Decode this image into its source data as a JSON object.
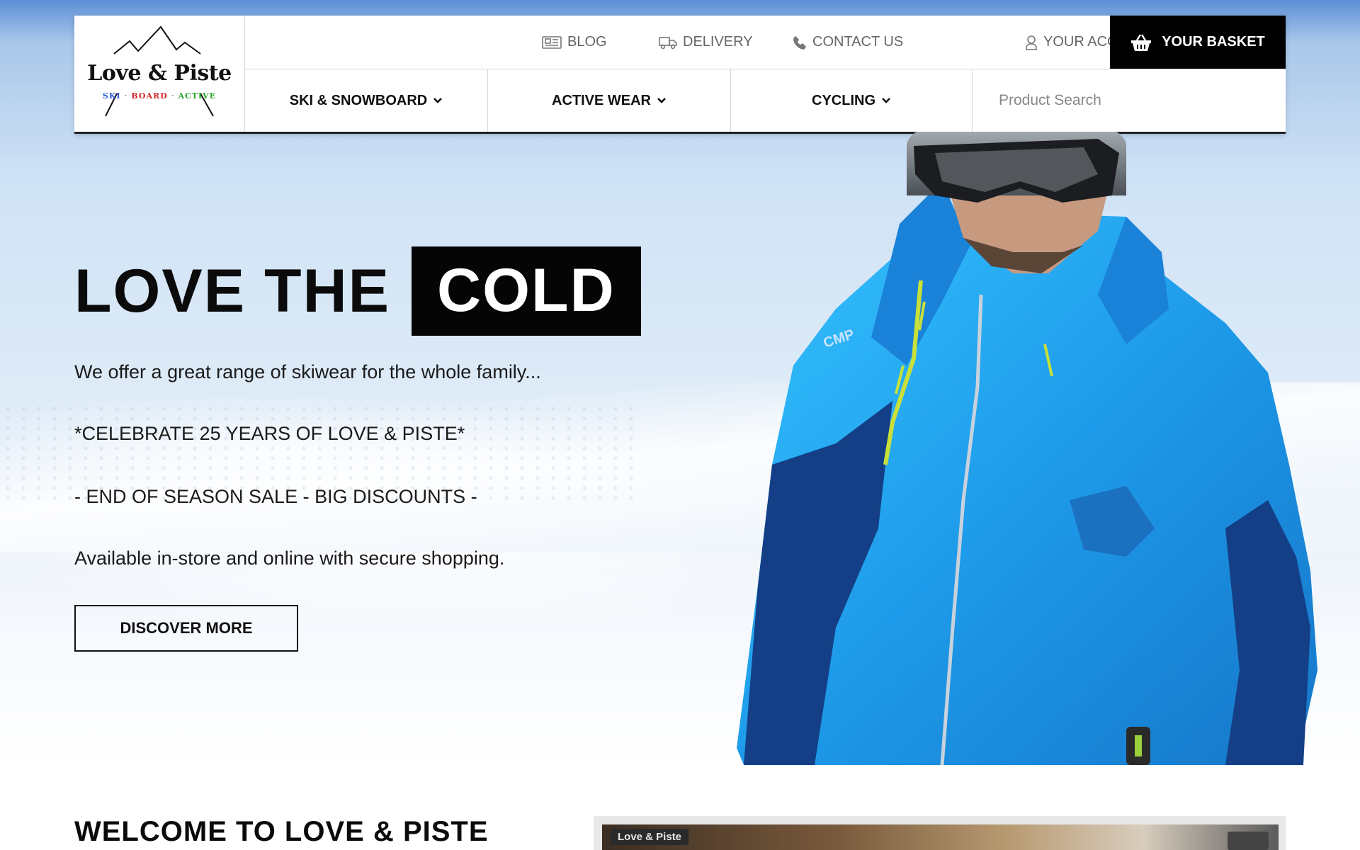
{
  "header": {
    "logo": {
      "name": "Love & Piste",
      "tag_ski": "SKI",
      "tag_board": "BOARD",
      "tag_active": "ACTIVE"
    },
    "top_links": [
      {
        "label": "BLOG",
        "icon": "newspaper-icon"
      },
      {
        "label": "DELIVERY",
        "icon": "truck-icon"
      },
      {
        "label": "CONTACT US",
        "icon": "phone-icon"
      },
      {
        "label": "YOUR ACCOUNT",
        "icon": "user-icon"
      }
    ],
    "basket": {
      "label": "YOUR BASKET",
      "icon": "basket-icon"
    },
    "nav": [
      {
        "label": "SKI & SNOWBOARD",
        "icon": "chevron-down-icon"
      },
      {
        "label": "ACTIVE WEAR",
        "icon": "chevron-down-icon"
      },
      {
        "label": "CYCLING",
        "icon": "chevron-down-icon"
      }
    ],
    "search": {
      "placeholder": "Product Search",
      "value": ""
    }
  },
  "hero": {
    "headline_plain": "LOVE THE",
    "headline_boxed": "COLD",
    "lines": [
      "We offer a great range of skiwear for the whole family...",
      "*CELEBRATE 25 YEARS OF LOVE & PISTE*",
      "- END OF SEASON SALE - BIG DISCOUNTS -",
      "Available in-store and online with secure shopping."
    ],
    "button": "DISCOVER MORE",
    "jacket_brand": "CMP"
  },
  "welcome": {
    "title": "WELCOME TO LOVE & PISTE",
    "video_label": "Love & Piste"
  },
  "colors": {
    "jacket": "#1e9bea",
    "jacket_dark": "#143f86",
    "zip": "#c8e03a",
    "basket_bg": "#000000"
  }
}
